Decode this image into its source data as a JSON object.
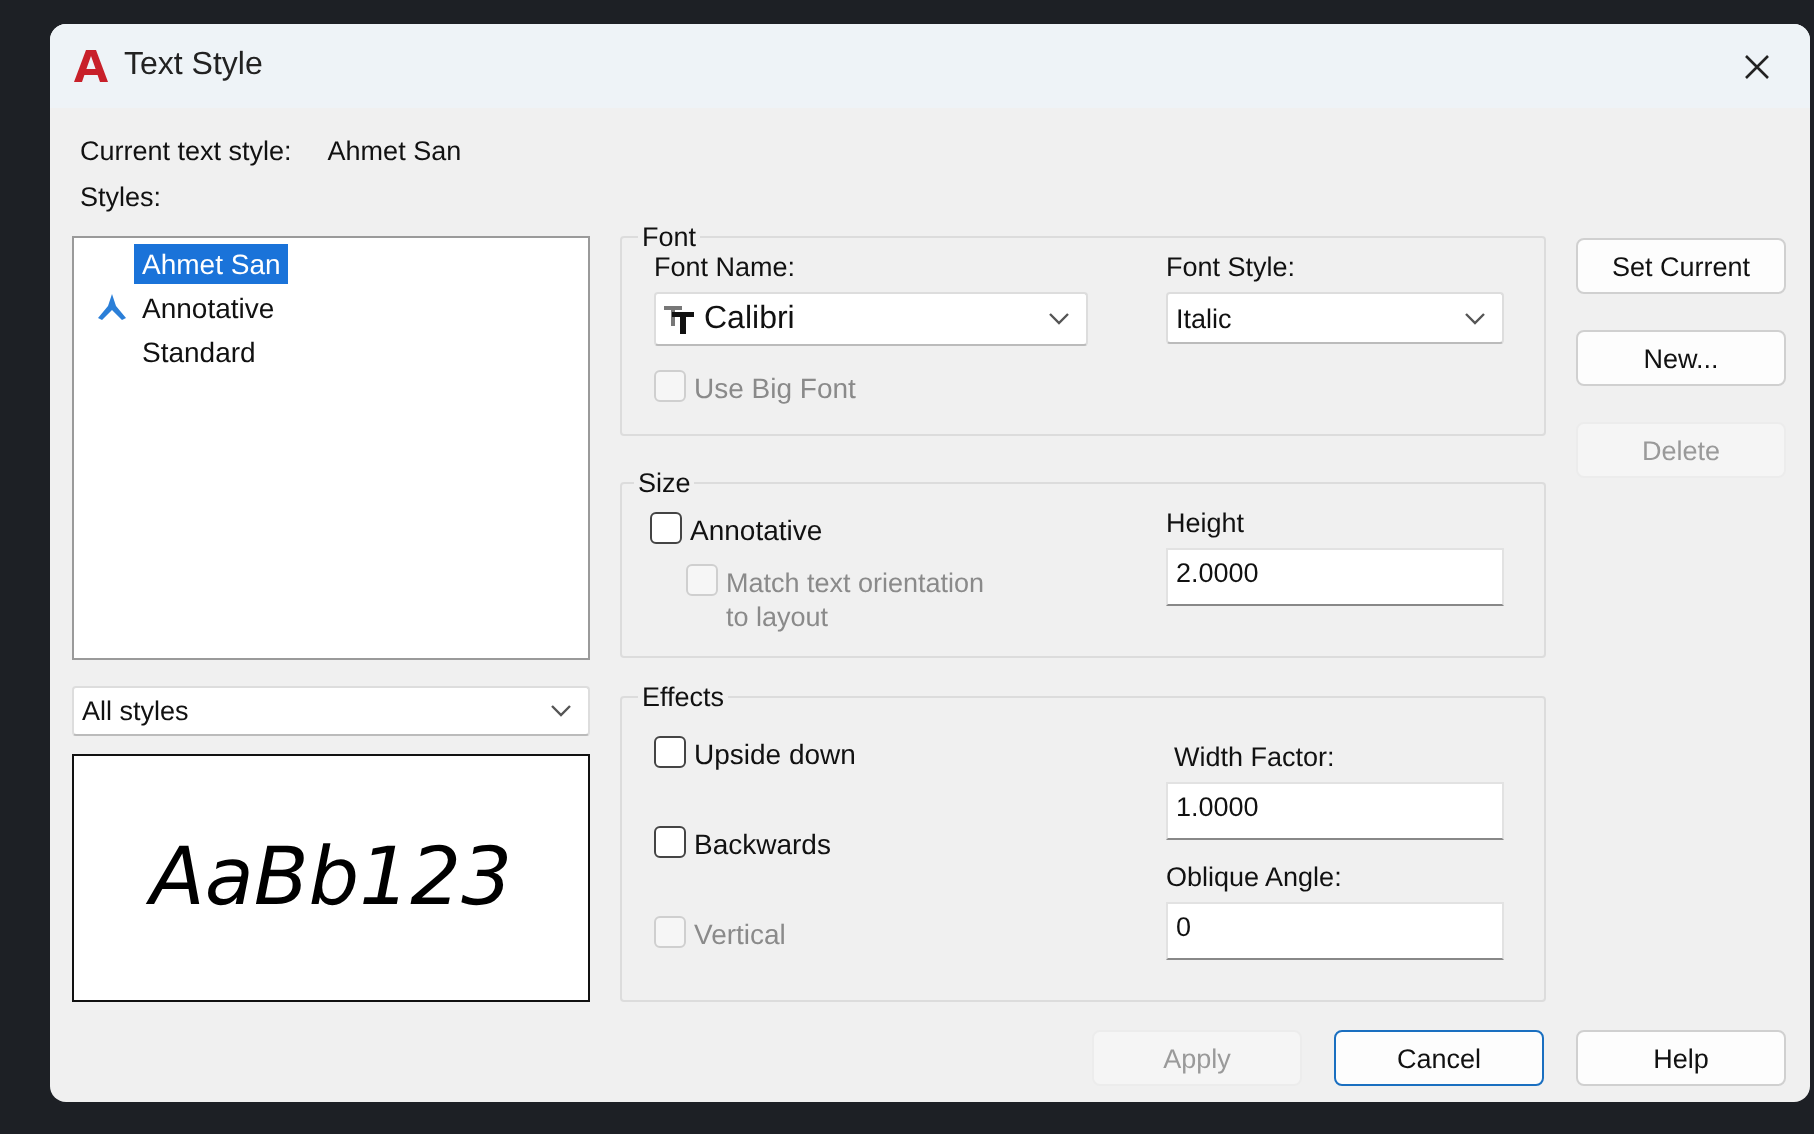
{
  "window": {
    "title": "Text Style"
  },
  "current_style": {
    "label": "Current text style:",
    "value": "Ahmet San"
  },
  "styles": {
    "label": "Styles:",
    "items": [
      {
        "name": "Ahmet San",
        "selected": true,
        "annotative": false
      },
      {
        "name": "Annotative",
        "selected": false,
        "annotative": true
      },
      {
        "name": "Standard",
        "selected": false,
        "annotative": false
      }
    ]
  },
  "filter": {
    "value": "All styles"
  },
  "preview": {
    "sample": "AaBb123"
  },
  "font": {
    "title": "Font",
    "font_name": {
      "label": "Font Name:",
      "value": "Calibri"
    },
    "font_style": {
      "label": "Font Style:",
      "value": "Italic"
    },
    "big_font": {
      "label": "Use Big Font",
      "checked": false,
      "disabled": true
    }
  },
  "size": {
    "title": "Size",
    "annotative": {
      "label": "Annotative",
      "checked": false,
      "disabled": false
    },
    "match_orientation": {
      "label": "Match text orientation to layout",
      "checked": false,
      "disabled": true
    },
    "height": {
      "label": "Height",
      "value": "2.0000"
    }
  },
  "effects": {
    "title": "Effects",
    "options": [
      {
        "label": "Upside down",
        "checked": false,
        "disabled": false
      },
      {
        "label": "Backwards",
        "checked": false,
        "disabled": false
      },
      {
        "label": "Vertical",
        "checked": false,
        "disabled": true
      }
    ],
    "width_factor": {
      "label": "Width Factor:",
      "value": "1.0000"
    },
    "oblique_angle": {
      "label": "Oblique Angle:",
      "value": "0"
    }
  },
  "side_buttons": [
    {
      "label": "Set Current",
      "disabled": false
    },
    {
      "label": "New...",
      "disabled": false
    },
    {
      "label": "Delete",
      "disabled": true
    }
  ],
  "buttons": [
    {
      "label": "Apply",
      "disabled": true,
      "focused": false
    },
    {
      "label": "Cancel",
      "disabled": false,
      "focused": true
    },
    {
      "label": "Help",
      "disabled": false,
      "focused": false
    }
  ]
}
